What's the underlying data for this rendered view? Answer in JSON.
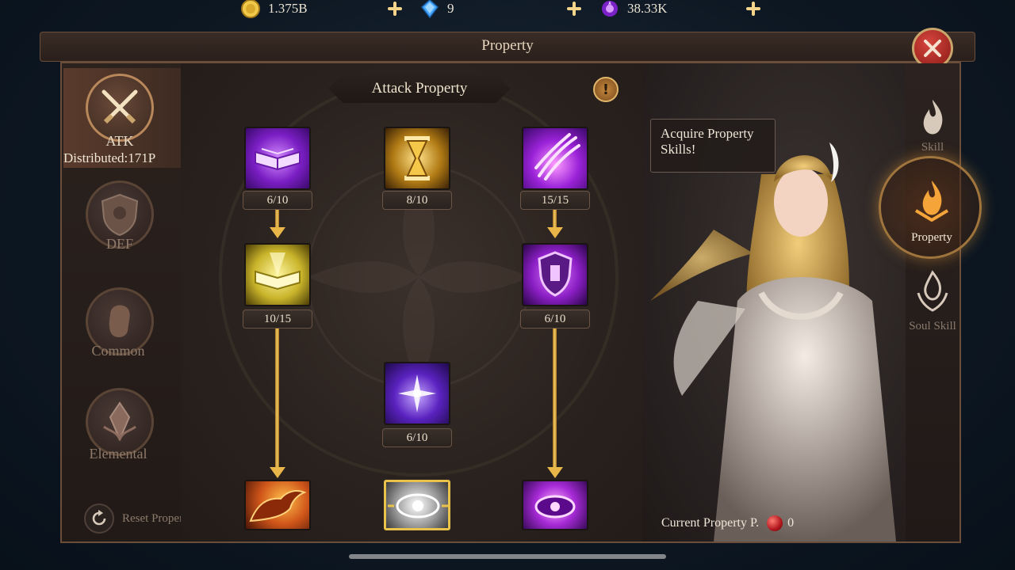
{
  "currencies": [
    {
      "name": "gold",
      "value": "1.375B",
      "color": "#f0c94a"
    },
    {
      "name": "diamond",
      "value": "9",
      "color": "#47a9ff"
    },
    {
      "name": "amethyst",
      "value": "38.33K",
      "color": "#b347ff"
    }
  ],
  "window": {
    "title": "Property",
    "close_icon": "close-icon"
  },
  "categories": [
    {
      "label": "ATK",
      "active": true,
      "icon": "crossed-swords-icon"
    },
    {
      "label": "DEF",
      "active": false,
      "icon": "shield-icon"
    },
    {
      "label": "Common",
      "active": false,
      "icon": "fist-icon"
    },
    {
      "label": "Elemental",
      "active": false,
      "icon": "crystal-icon"
    }
  ],
  "distributed": "Distributed:171P",
  "reset_label": "Reset Properties",
  "panel_header": "Attack Property",
  "nodes": [
    {
      "id": "book-purple",
      "count": "6/10",
      "icon": "spellbook-icon",
      "color": "#8a2ad6"
    },
    {
      "id": "hourglass",
      "count": "8/10",
      "icon": "hourglass-icon",
      "color": "#c99a2a"
    },
    {
      "id": "claw",
      "count": "15/15",
      "icon": "claw-slash-icon",
      "color": "#9a22d8"
    },
    {
      "id": "book-gold",
      "count": "10/15",
      "icon": "glowing-book-icon",
      "color": "#d6c23a"
    },
    {
      "id": "shield-rune",
      "count": "6/10",
      "icon": "rune-shield-icon",
      "color": "#8a1ec4"
    },
    {
      "id": "cross",
      "count": "6/10",
      "icon": "star-cross-icon",
      "color": "#6a2ac8"
    },
    {
      "id": "dragon",
      "count": "",
      "icon": "dragon-icon",
      "color": "#d66a1a"
    },
    {
      "id": "eye-rune",
      "count": "",
      "icon": "eye-rune-icon",
      "color": "#bcbcbc"
    },
    {
      "id": "eye-purple",
      "count": "",
      "icon": "purple-eye-icon",
      "color": "#a62ad6"
    }
  ],
  "hero": {
    "speech": "Acquire Property Skills!"
  },
  "tabs": [
    {
      "label": "Skill",
      "active": false,
      "icon": "flame-skill-icon"
    },
    {
      "label": "Property",
      "active": true,
      "icon": "flame-property-icon"
    },
    {
      "label": "Soul Skill",
      "active": false,
      "icon": "soul-skill-icon"
    }
  ],
  "property_points": {
    "label": "Current Property P.",
    "value": "0"
  }
}
